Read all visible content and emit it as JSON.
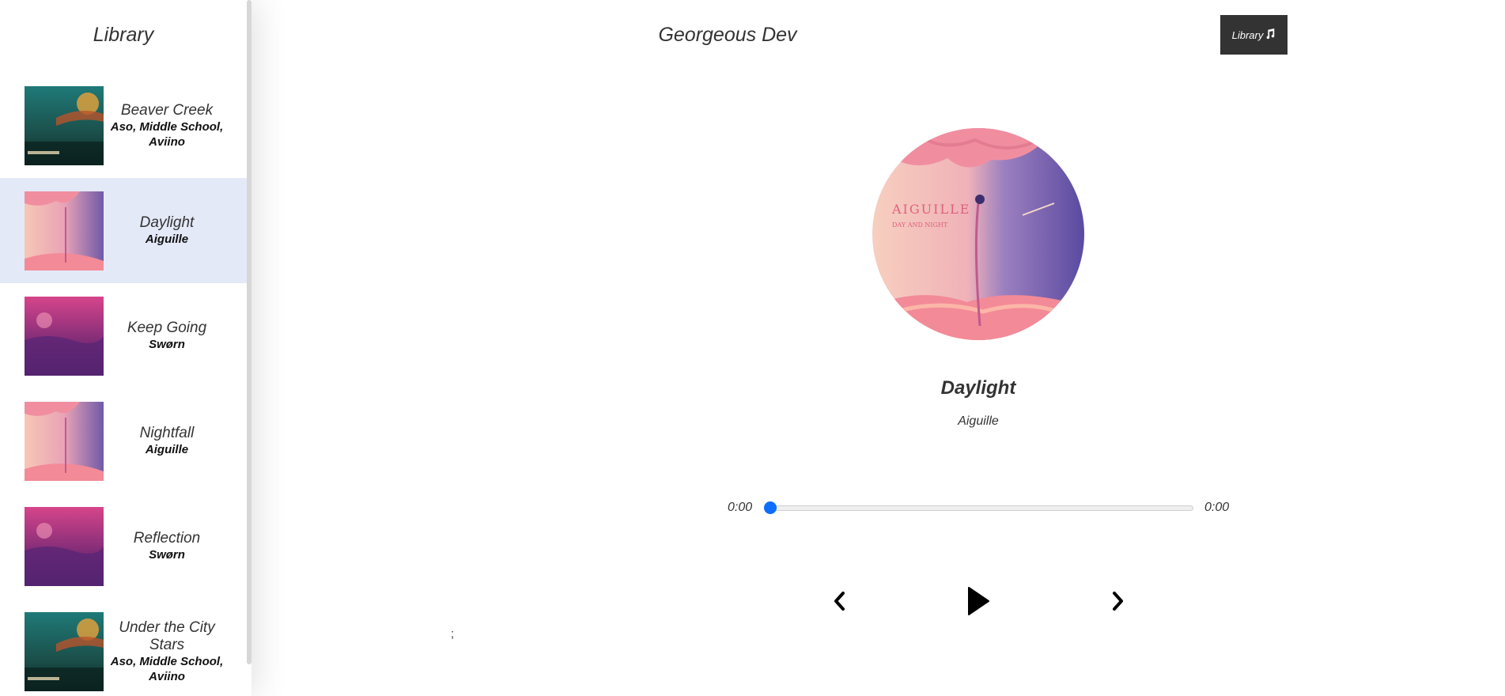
{
  "nav": {
    "title": "Georgeous Dev",
    "library_button_label": "Library",
    "library_button_icon": "music-note-icon"
  },
  "library": {
    "title": "Library",
    "songs": [
      {
        "name": "Beaver Creek",
        "artist": "Aso, Middle School, Aviino",
        "cover": "teal",
        "active": false
      },
      {
        "name": "Daylight",
        "artist": "Aiguille",
        "cover": "pink-purple",
        "active": true
      },
      {
        "name": "Keep Going",
        "artist": "Swørn",
        "cover": "magenta",
        "active": false
      },
      {
        "name": "Nightfall",
        "artist": "Aiguille",
        "cover": "pink-purple",
        "active": false
      },
      {
        "name": "Reflection",
        "artist": "Swørn",
        "cover": "magenta",
        "active": false
      },
      {
        "name": "Under the City Stars",
        "artist": "Aso, Middle School, Aviino",
        "cover": "teal",
        "active": false
      }
    ]
  },
  "player": {
    "song_name": "Daylight",
    "artist": "Aiguille",
    "current_time": "0:00",
    "duration": "0:00",
    "progress": 0,
    "accent_color": "#0d6efd"
  },
  "controls": {
    "prev_icon": "chevron-left-icon",
    "play_icon": "play-icon",
    "next_icon": "chevron-right-icon"
  },
  "stray_text": ";"
}
